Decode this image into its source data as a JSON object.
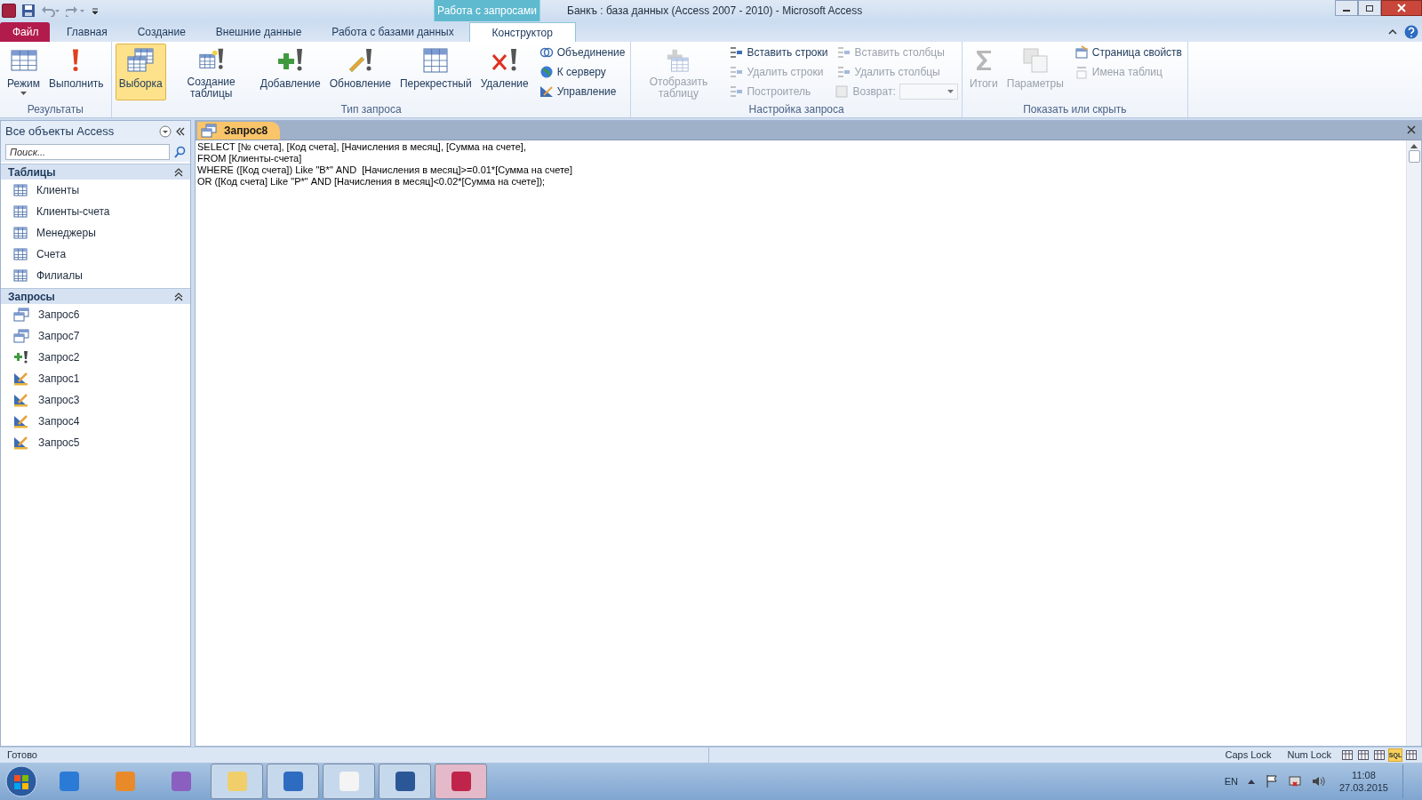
{
  "title_bar": {
    "contextual_tab": "Работа с запросами",
    "title": "Банкъ : база данных (Access 2007 - 2010)  -  Microsoft Access"
  },
  "tabs": [
    {
      "label": "Файл",
      "kind": "file",
      "selected": false
    },
    {
      "label": "Главная",
      "kind": "normal",
      "selected": false
    },
    {
      "label": "Создание",
      "kind": "normal",
      "selected": false
    },
    {
      "label": "Внешние данные",
      "kind": "normal",
      "selected": false
    },
    {
      "label": "Работа с базами данных",
      "kind": "normal",
      "selected": false
    },
    {
      "label": "Конструктор",
      "kind": "contextual",
      "selected": true
    }
  ],
  "ribbon_groups": [
    {
      "title": "Результаты",
      "items": [
        {
          "kind": "large",
          "label": "Режим",
          "dropdown": true,
          "disabled": false,
          "selected": false
        },
        {
          "kind": "large",
          "label": "Выполнить",
          "dropdown": false,
          "disabled": false,
          "selected": false
        }
      ]
    },
    {
      "title": "Тип запроса",
      "items": [
        {
          "kind": "large",
          "label": "Выборка",
          "dropdown": false,
          "disabled": false,
          "selected": true
        },
        {
          "kind": "large",
          "label": "Создание таблицы",
          "dropdown": false,
          "disabled": false,
          "selected": false
        },
        {
          "kind": "large",
          "label": "Добавление",
          "dropdown": false,
          "disabled": false,
          "selected": false
        },
        {
          "kind": "large",
          "label": "Обновление",
          "dropdown": false,
          "disabled": false,
          "selected": false
        },
        {
          "kind": "large",
          "label": "Перекрестный",
          "dropdown": false,
          "disabled": false,
          "selected": false
        },
        {
          "kind": "large",
          "label": "Удаление",
          "dropdown": false,
          "disabled": false,
          "selected": false
        },
        {
          "kind": "small",
          "label": "Объединение",
          "disabled": false
        },
        {
          "kind": "small",
          "label": "К серверу",
          "disabled": false
        },
        {
          "kind": "small",
          "label": "Управление",
          "disabled": false
        }
      ]
    },
    {
      "title": "Настройка запроса",
      "items": [
        {
          "kind": "large",
          "label": "Отобразить таблицу",
          "dropdown": false,
          "disabled": true,
          "selected": false
        },
        {
          "kind": "small",
          "label": "Вставить строки",
          "disabled": false
        },
        {
          "kind": "small",
          "label": "Удалить строки",
          "disabled": true
        },
        {
          "kind": "small",
          "label": "Построитель",
          "disabled": true
        },
        {
          "kind": "small",
          "label": "Вставить столбцы",
          "disabled": true
        },
        {
          "kind": "small",
          "label": "Удалить столбцы",
          "disabled": true
        },
        {
          "kind": "combo",
          "label": "Возврат:",
          "disabled": true
        }
      ]
    },
    {
      "title": "Показать или скрыть",
      "items": [
        {
          "kind": "large",
          "label": "Итоги",
          "dropdown": false,
          "disabled": true,
          "selected": false
        },
        {
          "kind": "large",
          "label": "Параметры",
          "dropdown": false,
          "disabled": true,
          "selected": false
        },
        {
          "kind": "small",
          "label": "Страница свойств",
          "disabled": false
        },
        {
          "kind": "small",
          "label": "Имена таблиц",
          "disabled": true
        }
      ]
    }
  ],
  "nav_pane": {
    "title": "Все объекты Access",
    "search": {
      "placeholder": "Поиск..."
    },
    "sections": [
      {
        "title": "Таблицы",
        "expanded": true,
        "items": [
          {
            "label": "Клиенты",
            "kind": "table"
          },
          {
            "label": "Клиенты-счета",
            "kind": "table"
          },
          {
            "label": "Менеджеры",
            "kind": "table"
          },
          {
            "label": "Счета",
            "kind": "table"
          },
          {
            "label": "Филиалы",
            "kind": "table"
          }
        ]
      },
      {
        "title": "Запросы",
        "expanded": true,
        "items": [
          {
            "label": "Запрос6",
            "kind": "select"
          },
          {
            "label": "Запрос7",
            "kind": "select"
          },
          {
            "label": "Запрос2",
            "kind": "append"
          },
          {
            "label": "Запрос1",
            "kind": "update"
          },
          {
            "label": "Запрос3",
            "kind": "update"
          },
          {
            "label": "Запрос4",
            "kind": "update"
          },
          {
            "label": "Запрос5",
            "kind": "update"
          }
        ]
      }
    ]
  },
  "document": {
    "tabs": [
      {
        "label": "Запрос8",
        "selected": true
      }
    ],
    "sql_lines": [
      "SELECT [№ счета], [Код счета], [Начисления в месяц], [Сумма на счете],",
      "FROM [Клиенты-счета]",
      "WHERE ([Код счета]) Like \"В*\" AND  [Начисления в месяц]>=0.01*[Сумма на счете]",
      "OR ([Код счета] Like \"Р*\" AND [Начисления в месяц]<0.02*[Сумма на счете]);"
    ]
  },
  "status_bar": {
    "message": "Готово",
    "indicators": [
      "Caps Lock",
      "Num Lock"
    ],
    "views": [
      {
        "selected": false
      },
      {
        "selected": false
      },
      {
        "selected": false
      },
      {
        "selected": true,
        "label": "SQL"
      },
      {
        "selected": false
      }
    ]
  },
  "taskbar": {
    "apps": [
      {
        "running": false
      },
      {
        "running": false
      },
      {
        "running": false
      },
      {
        "running": true
      },
      {
        "running": true
      },
      {
        "running": true
      },
      {
        "running": true
      },
      {
        "running": true,
        "active": true
      }
    ],
    "language": "EN",
    "time": "11:08",
    "date": "27.03.2015"
  }
}
